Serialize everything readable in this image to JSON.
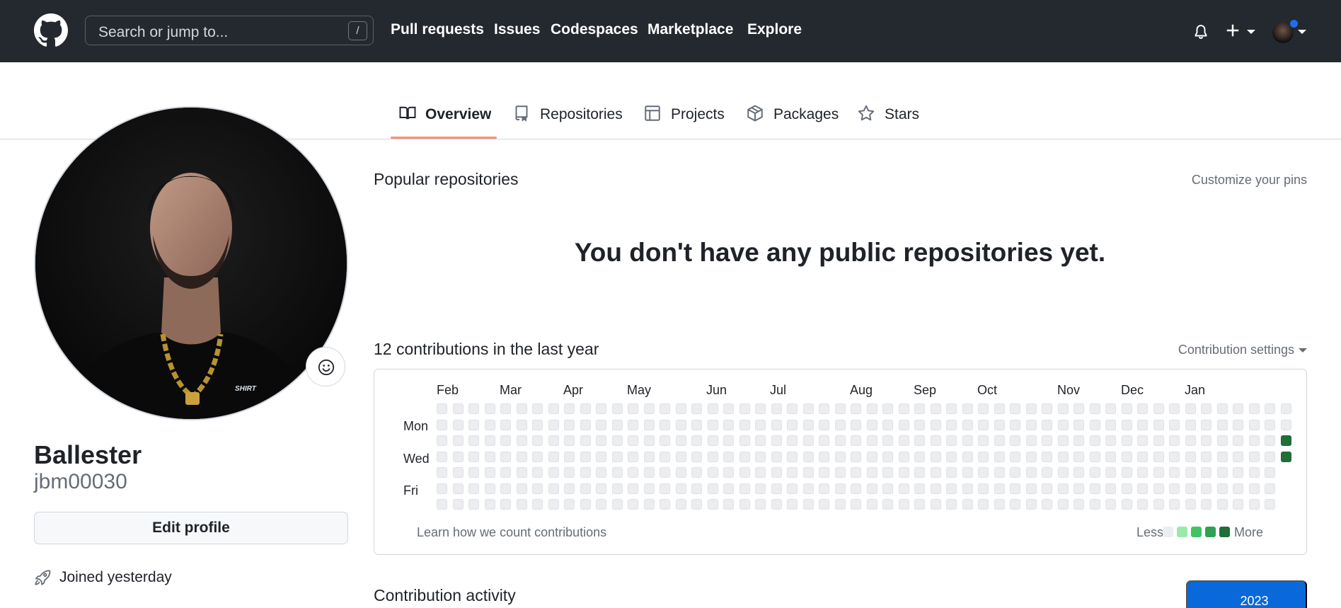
{
  "header": {
    "search_placeholder": "Search or jump to...",
    "search_shortcut": "/",
    "nav": [
      "Pull requests",
      "Issues",
      "Codespaces",
      "Marketplace",
      "Explore"
    ]
  },
  "tabs": [
    "Overview",
    "Repositories",
    "Projects",
    "Packages",
    "Stars"
  ],
  "profile": {
    "name": "Ballester",
    "login": "jbm00030",
    "edit_label": "Edit profile",
    "joined": "Joined yesterday"
  },
  "popular": {
    "title": "Popular repositories",
    "customize": "Customize your pins",
    "empty_message": "You don't have any public repositories yet."
  },
  "contributions": {
    "title": "12 contributions in the last year",
    "settings_label": "Contribution settings",
    "months": [
      "Feb",
      "Mar",
      "Apr",
      "May",
      "Jun",
      "Jul",
      "Aug",
      "Sep",
      "Oct",
      "Nov",
      "Dec",
      "Jan"
    ],
    "day_labels": [
      "Mon",
      "Wed",
      "Fri"
    ],
    "learn_link": "Learn how we count contributions",
    "legend_less": "Less",
    "legend_more": "More",
    "legend_colors": [
      "#ebedf0",
      "#9be9a8",
      "#40c463",
      "#30a14e",
      "#216e39"
    ],
    "active_cells": [
      {
        "week": 53,
        "day": 2,
        "level": 4
      },
      {
        "week": 53,
        "day": 3,
        "level": 4
      }
    ]
  },
  "activity": {
    "title": "Contribution activity",
    "year": "2023"
  }
}
